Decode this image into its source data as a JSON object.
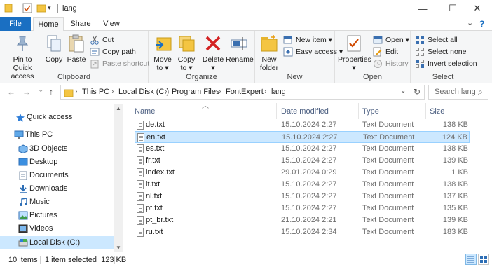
{
  "window": {
    "title": "lang",
    "minimize_glyph": "—",
    "maximize_glyph": "☐",
    "close_glyph": "✕",
    "help_glyph": "?",
    "collapse_glyph": "⌄"
  },
  "tabs": {
    "file": "File",
    "home": "Home",
    "share": "Share",
    "view": "View"
  },
  "ribbon": {
    "clipboard": {
      "label": "Clipboard",
      "pin_line1": "Pin to Quick",
      "pin_line2": "access",
      "copy": "Copy",
      "paste": "Paste",
      "cut": "Cut",
      "copy_path": "Copy path",
      "paste_shortcut": "Paste shortcut"
    },
    "organize": {
      "label": "Organize",
      "move_line1": "Move",
      "move_line2": "to ▾",
      "copy_line1": "Copy",
      "copy_line2": "to ▾",
      "delete": "Delete ▾",
      "rename": "Rename"
    },
    "new": {
      "label": "New",
      "folder_line1": "New",
      "folder_line2": "folder",
      "new_item": "New item ▾",
      "easy_access": "Easy access ▾"
    },
    "open": {
      "label": "Open",
      "properties": "Properties",
      "properties_arrow": "▾",
      "open": "Open ▾",
      "edit": "Edit",
      "history": "History"
    },
    "select": {
      "label": "Select",
      "select_all": "Select all",
      "select_none": "Select none",
      "invert": "Invert selection"
    }
  },
  "nav": {
    "back": "←",
    "forward": "→",
    "recent": "⌄",
    "up": "↑",
    "breadcrumb": [
      "This PC",
      "Local Disk (C:)",
      "Program Files",
      "FontExpert",
      "lang"
    ],
    "crumb_sep": "›",
    "dropdown": "⌄",
    "refresh": "↻",
    "search_placeholder": "Search lang",
    "search_glyph": "⌕"
  },
  "navpane": {
    "items": [
      {
        "label": "Quick access",
        "icon": "star-icon"
      },
      {
        "label": "This PC",
        "icon": "computer-icon"
      },
      {
        "label": "3D Objects",
        "icon": "cube-icon"
      },
      {
        "label": "Desktop",
        "icon": "desktop-icon"
      },
      {
        "label": "Documents",
        "icon": "documents-icon"
      },
      {
        "label": "Downloads",
        "icon": "download-icon"
      },
      {
        "label": "Music",
        "icon": "music-icon"
      },
      {
        "label": "Pictures",
        "icon": "pictures-icon"
      },
      {
        "label": "Videos",
        "icon": "video-icon"
      },
      {
        "label": "Local Disk (C:)",
        "icon": "drive-icon"
      }
    ],
    "scroll_up": "▲",
    "scroll_down": "▼"
  },
  "filelist": {
    "sort_glyph": "︿",
    "columns": {
      "name": "Name",
      "date": "Date modified",
      "type": "Type",
      "size": "Size"
    },
    "rows": [
      {
        "name": "de.txt",
        "date": "15.10.2024 2:27",
        "type": "Text Document",
        "size": "138 KB",
        "selected": false
      },
      {
        "name": "en.txt",
        "date": "15.10.2024 2:27",
        "type": "Text Document",
        "size": "124 KB",
        "selected": true
      },
      {
        "name": "es.txt",
        "date": "15.10.2024 2:27",
        "type": "Text Document",
        "size": "138 KB",
        "selected": false
      },
      {
        "name": "fr.txt",
        "date": "15.10.2024 2:27",
        "type": "Text Document",
        "size": "139 KB",
        "selected": false
      },
      {
        "name": "index.txt",
        "date": "29.01.2024 0:29",
        "type": "Text Document",
        "size": "1 KB",
        "selected": false
      },
      {
        "name": "it.txt",
        "date": "15.10.2024 2:27",
        "type": "Text Document",
        "size": "138 KB",
        "selected": false
      },
      {
        "name": "nl.txt",
        "date": "15.10.2024 2:27",
        "type": "Text Document",
        "size": "137 KB",
        "selected": false
      },
      {
        "name": "pt.txt",
        "date": "15.10.2024 2:27",
        "type": "Text Document",
        "size": "135 KB",
        "selected": false
      },
      {
        "name": "pt_br.txt",
        "date": "21.10.2024 2:21",
        "type": "Text Document",
        "size": "139 KB",
        "selected": false
      },
      {
        "name": "ru.txt",
        "date": "15.10.2024 2:34",
        "type": "Text Document",
        "size": "183 KB",
        "selected": false
      }
    ]
  },
  "status": {
    "items_count": "10 items",
    "selection": "1 item selected  123 KB"
  },
  "colors": {
    "accent": "#1a6fc2",
    "selection_bg": "#cce8ff",
    "selection_border": "#99d1ff",
    "folder_yellow": "#f4c542"
  }
}
